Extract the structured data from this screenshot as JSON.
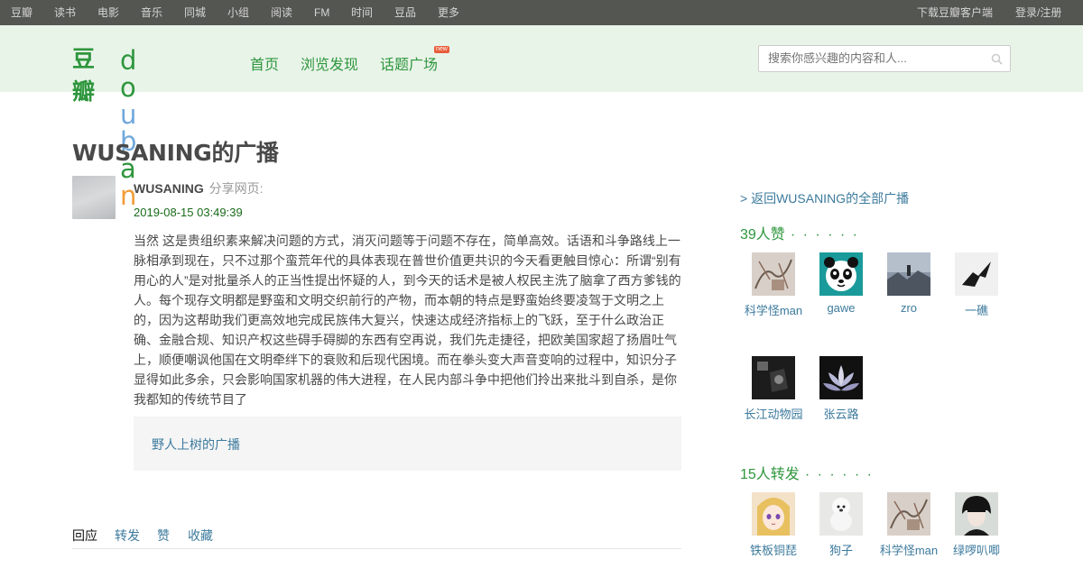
{
  "global_nav": {
    "links": [
      "豆瓣",
      "读书",
      "电影",
      "音乐",
      "同城",
      "小组",
      "阅读",
      "FM",
      "时间",
      "豆品",
      "更多"
    ],
    "download": "下载豆瓣客户端",
    "login": "登录/注册"
  },
  "header": {
    "logo_cn": "豆瓣",
    "logo_en": "douban",
    "nav": [
      "首页",
      "浏览发现",
      "话题广场"
    ],
    "new_badge": "new",
    "search_placeholder": "搜索你感兴趣的内容和人..."
  },
  "page": {
    "title": "WUSANING的广播"
  },
  "status": {
    "author": "WUSANING",
    "action": "分享网页:",
    "timestamp": "2019-08-15 03:49:39",
    "content": "当然 这是贵组织素来解决问题的方式，消灭问题等于问题不存在，简单高效。话语和斗争路线上一脉相承到现在，只不过那个蛮荒年代的具体表现在普世价值更共识的今天看更触目惊心：所谓“别有用心的人”是对批量杀人的正当性提出怀疑的人，到今天的话术是被人权民主洗了脑拿了西方爹钱的人。每个现存文明都是野蛮和文明交织前行的产物，而本朝的特点是野蛮始终要凌驾于文明之上的，因为这帮助我们更高效地完成民族伟大复兴，快速达成经济指标上的飞跃，至于什么政治正确、金融合规、知识产权这些碍手碍脚的东西有空再说，我们先走捷径，把欧美国家超了扬眉吐气上，顺便嘲讽他国在文明牵绊下的衰败和后现代困境。而在拳头变大声音变响的过程中，知识分子显得如此多余，只会影响国家机器的伟大进程，在人民内部斗争中把他们拎出来批斗到自杀，是你我都知的传统节目了",
    "shared_link": "野人上树的广播"
  },
  "tabs": [
    "回应",
    "转发",
    "赞",
    "收藏"
  ],
  "sidebar": {
    "back_link": "> 返回WUSANING的全部广播",
    "likes_title": "39人赞",
    "reshares_title": "15人转发",
    "dots": "· · · · · ·",
    "likers": [
      {
        "name": "科学怪man",
        "icon": "sketch-avatar-icon"
      },
      {
        "name": "gawe",
        "icon": "panda-avatar-icon"
      },
      {
        "name": "zro",
        "icon": "landscape-avatar-icon"
      },
      {
        "name": "一礁",
        "icon": "bird-avatar-icon"
      },
      {
        "name": "长江动物园",
        "icon": "dark-photo-avatar-icon"
      },
      {
        "name": "张云路",
        "icon": "lotus-avatar-icon"
      }
    ],
    "resharers": [
      {
        "name": "铁板铜琵",
        "icon": "anime-girl-avatar-icon"
      },
      {
        "name": "狗子",
        "icon": "dog-avatar-icon"
      },
      {
        "name": "科学怪man",
        "icon": "sketch-avatar-icon"
      },
      {
        "name": "绿啰叭唧",
        "icon": "portrait-avatar-icon"
      }
    ]
  },
  "colors": {
    "brand_green": "#2e963d",
    "link_blue": "#3c7a9d",
    "nav_bg": "#545652",
    "header_bg": "#e9f4e9"
  }
}
